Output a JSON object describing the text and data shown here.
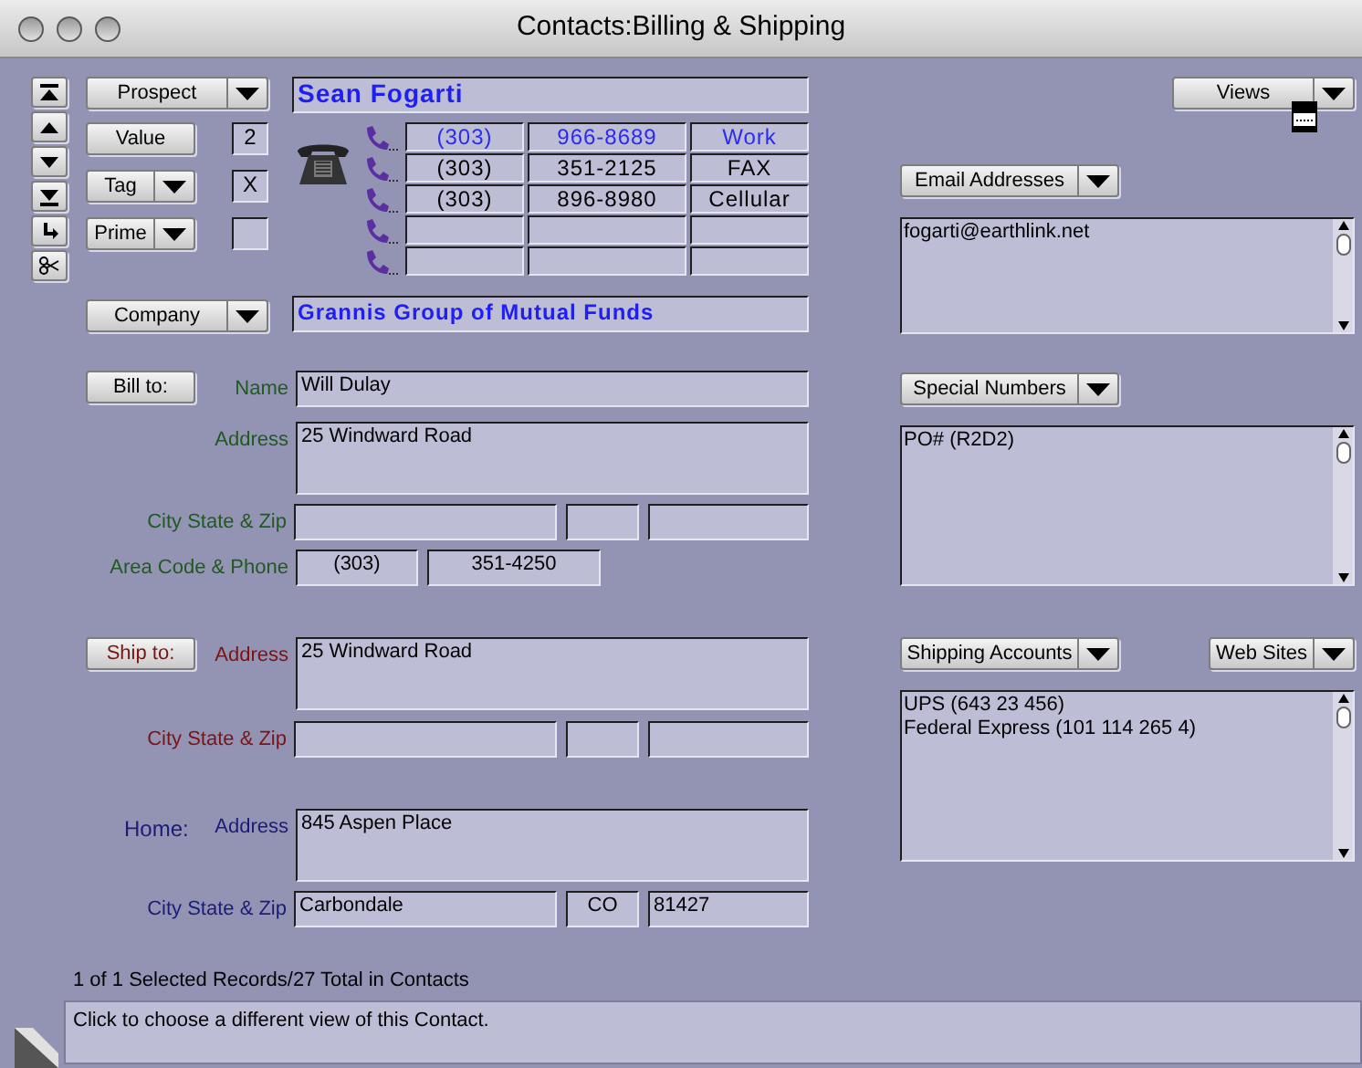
{
  "window": {
    "title": "Contacts:Billing & Shipping"
  },
  "header": {
    "category_menu": "Prospect",
    "value_button": "Value",
    "value": "2",
    "tag_menu": "Tag",
    "tag": "X",
    "prime_menu": "Prime"
  },
  "contact_name": "Sean Fogarti",
  "phones": [
    {
      "area": "(303)",
      "number": "966-8689",
      "label": "Work",
      "selected": true
    },
    {
      "area": "(303)",
      "number": "351-2125",
      "label": "FAX",
      "selected": false
    },
    {
      "area": "(303)",
      "number": "896-8980",
      "label": "Cellular",
      "selected": false
    }
  ],
  "company_menu": "Company",
  "company": "Grannis Group of Mutual Funds",
  "bill_to": {
    "button": "Bill to:",
    "name_label": "Name",
    "name": "Will Dulay",
    "address_label": "Address",
    "address": "25 Windward Road",
    "city_label": "City State & Zip",
    "phone_label": "Area Code & Phone",
    "area_code": "(303)",
    "phone": "351-4250"
  },
  "ship_to": {
    "button": "Ship to:",
    "address_label": "Address",
    "address": "25 Windward Road",
    "city_label": "City State & Zip"
  },
  "home": {
    "heading": "Home:",
    "address_label": "Address",
    "address": "845 Aspen Place",
    "city_label": "City State & Zip",
    "city": "Carbondale",
    "state": "CO",
    "zip": "81427"
  },
  "views_menu": "Views",
  "lists": [
    {
      "menu": "Email Addresses",
      "lines": [
        "fogarti@earthlink.net"
      ]
    },
    {
      "menu": "Special Numbers",
      "lines": [
        "PO# (R2D2)"
      ]
    },
    {
      "menu": "Shipping Accounts",
      "extra_menu": "Web Sites",
      "lines": [
        "UPS (643 23 456)",
        "Federal Express (101 114 265 4)"
      ]
    }
  ],
  "status_bar": {
    "records": "1 of 1 Selected Records/27 Total in Contacts",
    "message": "Click to choose a different view of this Contact."
  }
}
